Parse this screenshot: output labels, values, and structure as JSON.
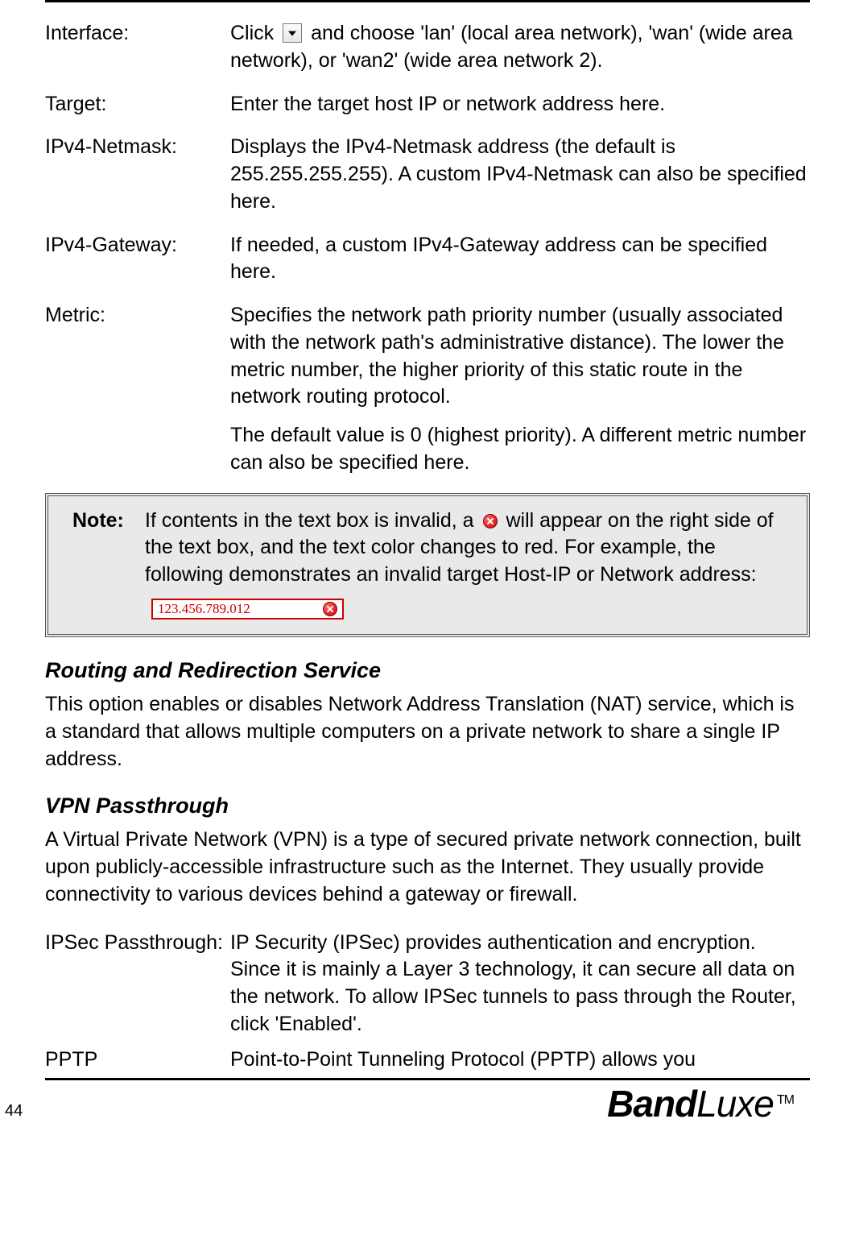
{
  "defs": [
    {
      "term": "Interface:",
      "pre": "Click ",
      "post": " and choose 'lan' (local area network), 'wan' (wide area network), or 'wan2' (wide area network 2)."
    },
    {
      "term": "Target:",
      "body": "Enter the target host IP or network address here."
    },
    {
      "term": "IPv4-Netmask:",
      "body": "Displays the IPv4-Netmask address (the default is 255.255.255.255). A custom IPv4-Netmask can also be specified here."
    },
    {
      "term": "IPv4-Gateway:",
      "body": "If needed, a custom IPv4-Gateway address can be specified here."
    },
    {
      "term": "Metric:",
      "body": "Specifies the network path priority number (usually associated with the network path's administrative distance). The lower the metric number, the higher priority of this static route in the network routing protocol.",
      "body2": "The default value is 0 (highest priority). A different metric number can also be specified here."
    }
  ],
  "note": {
    "label": "Note:",
    "pre": "If contents in the text box is invalid, a ",
    "mid": " will appear on the right side of the text box, and the text color changes to red. For example, the following demonstrates an invalid target Host-IP or Network address: ",
    "sample": "123.456.789.012"
  },
  "sections": [
    {
      "heading": "Routing and Redirection Service",
      "para": "This option enables or disables Network Address Translation (NAT) service, which is a standard that allows multiple computers on a private network to share a single IP address."
    },
    {
      "heading": "VPN Passthrough",
      "para": "A Virtual Private Network (VPN) is a type of secured private network connection, built upon publicly-accessible infrastructure such as the Internet. They usually provide connectivity to various devices behind a gateway or firewall."
    }
  ],
  "defs2": [
    {
      "term": "IPSec Passthrough:",
      "body": "IP Security (IPSec) provides authentication and encryption. Since it is mainly a Layer 3 technology, it can secure all data on the network. To allow IPSec tunnels to pass through the Router, click 'Enabled'."
    },
    {
      "term": "PPTP",
      "body": "Point-to-Point Tunneling Protocol (PPTP) allows you"
    }
  ],
  "page_number": "44",
  "brand": {
    "b": "Band",
    "l": "Luxe",
    "tm": "TM"
  }
}
